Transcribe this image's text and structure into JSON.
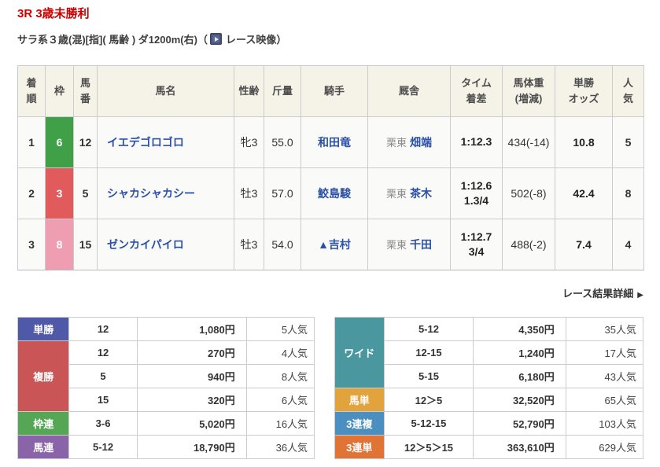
{
  "page": {
    "title": "3R 3歳未勝利",
    "subtitle": "サラ系３歳(混)[指]( 馬齢 ) ダ1200m(右)",
    "paren_open": "（",
    "video_link": "レース映像",
    "paren_close": "）",
    "detail_link": "レース結果詳細",
    "detail_arrow": "▶"
  },
  "colors": {
    "title_red": "#cc0000",
    "link_blue": "#2b50a8",
    "header_beige": "#f5f2e8",
    "waku_green": "#3fa048",
    "waku_red": "#e25b5c",
    "waku_pink": "#ef9db0"
  },
  "results": {
    "headers": [
      "着\n順",
      "枠",
      "馬\n番",
      "馬名",
      "性齢",
      "斤量",
      "騎手",
      "厩舎",
      "タイム\n着差",
      "馬体重\n(増減)",
      "単勝\nオッズ",
      "人\n気"
    ],
    "rows": [
      {
        "pos": "1",
        "waku": "6",
        "waku_color": "#3fa048",
        "num": "12",
        "name": "イエデゴロゴロ",
        "sexage": "牝3",
        "weight": "55.0",
        "jockey": "和田竜",
        "stable_region": "栗東",
        "trainer": "畑端",
        "time": "1:12.3",
        "hweight": "434(-14)",
        "odds": "10.8",
        "pop": "5"
      },
      {
        "pos": "2",
        "waku": "3",
        "waku_color": "#e25b5c",
        "num": "5",
        "name": "シャカシャカシー",
        "sexage": "牡3",
        "weight": "57.0",
        "jockey": "鮫島駿",
        "stable_region": "栗東",
        "trainer": "茶木",
        "time": "1:12.6\n1.3/4",
        "hweight": "502(-8)",
        "odds": "42.4",
        "pop": "8"
      },
      {
        "pos": "3",
        "waku": "8",
        "waku_color": "#ef9db0",
        "num": "15",
        "name": "ゼンカイパイロ",
        "sexage": "牡3",
        "weight": "54.0",
        "jockey": "▲吉村",
        "stable_region": "栗東",
        "trainer": "千田",
        "time": "1:12.7\n3/4",
        "hweight": "488(-2)",
        "odds": "7.4",
        "pop": "4"
      }
    ]
  },
  "payouts_left": {
    "tansho": {
      "label": "単勝",
      "color": "#5058a8",
      "num": "12",
      "amount": "1,080円",
      "pop": "5人気"
    },
    "fukusho": {
      "label": "複勝",
      "color": "#c95556",
      "rows": [
        {
          "num": "12",
          "amount": "270円",
          "pop": "4人気"
        },
        {
          "num": "5",
          "amount": "940円",
          "pop": "8人気"
        },
        {
          "num": "15",
          "amount": "320円",
          "pop": "6人気"
        }
      ]
    },
    "wakuren": {
      "label": "枠連",
      "color": "#55a755",
      "num": "3-6",
      "amount": "5,020円",
      "pop": "16人気"
    },
    "umaren": {
      "label": "馬連",
      "color": "#8a64a8",
      "num": "5-12",
      "amount": "18,790円",
      "pop": "36人気"
    }
  },
  "payouts_right": {
    "wide": {
      "label": "ワイド",
      "color": "#4a97a0",
      "rows": [
        {
          "num": "5-12",
          "amount": "4,350円",
          "pop": "35人気"
        },
        {
          "num": "12-15",
          "amount": "1,240円",
          "pop": "17人気"
        },
        {
          "num": "5-15",
          "amount": "6,180円",
          "pop": "43人気"
        }
      ]
    },
    "umatan": {
      "label": "馬単",
      "color": "#e3a33c",
      "num": "12＞5",
      "amount": "32,520円",
      "pop": "65人気"
    },
    "sanrenpuku": {
      "label": "3連複",
      "color": "#4a8fc0",
      "num": "5-12-15",
      "amount": "52,790円",
      "pop": "103人気"
    },
    "sanrentan": {
      "label": "3連単",
      "color": "#df7436",
      "num": "12＞5＞15",
      "amount": "363,610円",
      "pop": "629人気"
    }
  }
}
